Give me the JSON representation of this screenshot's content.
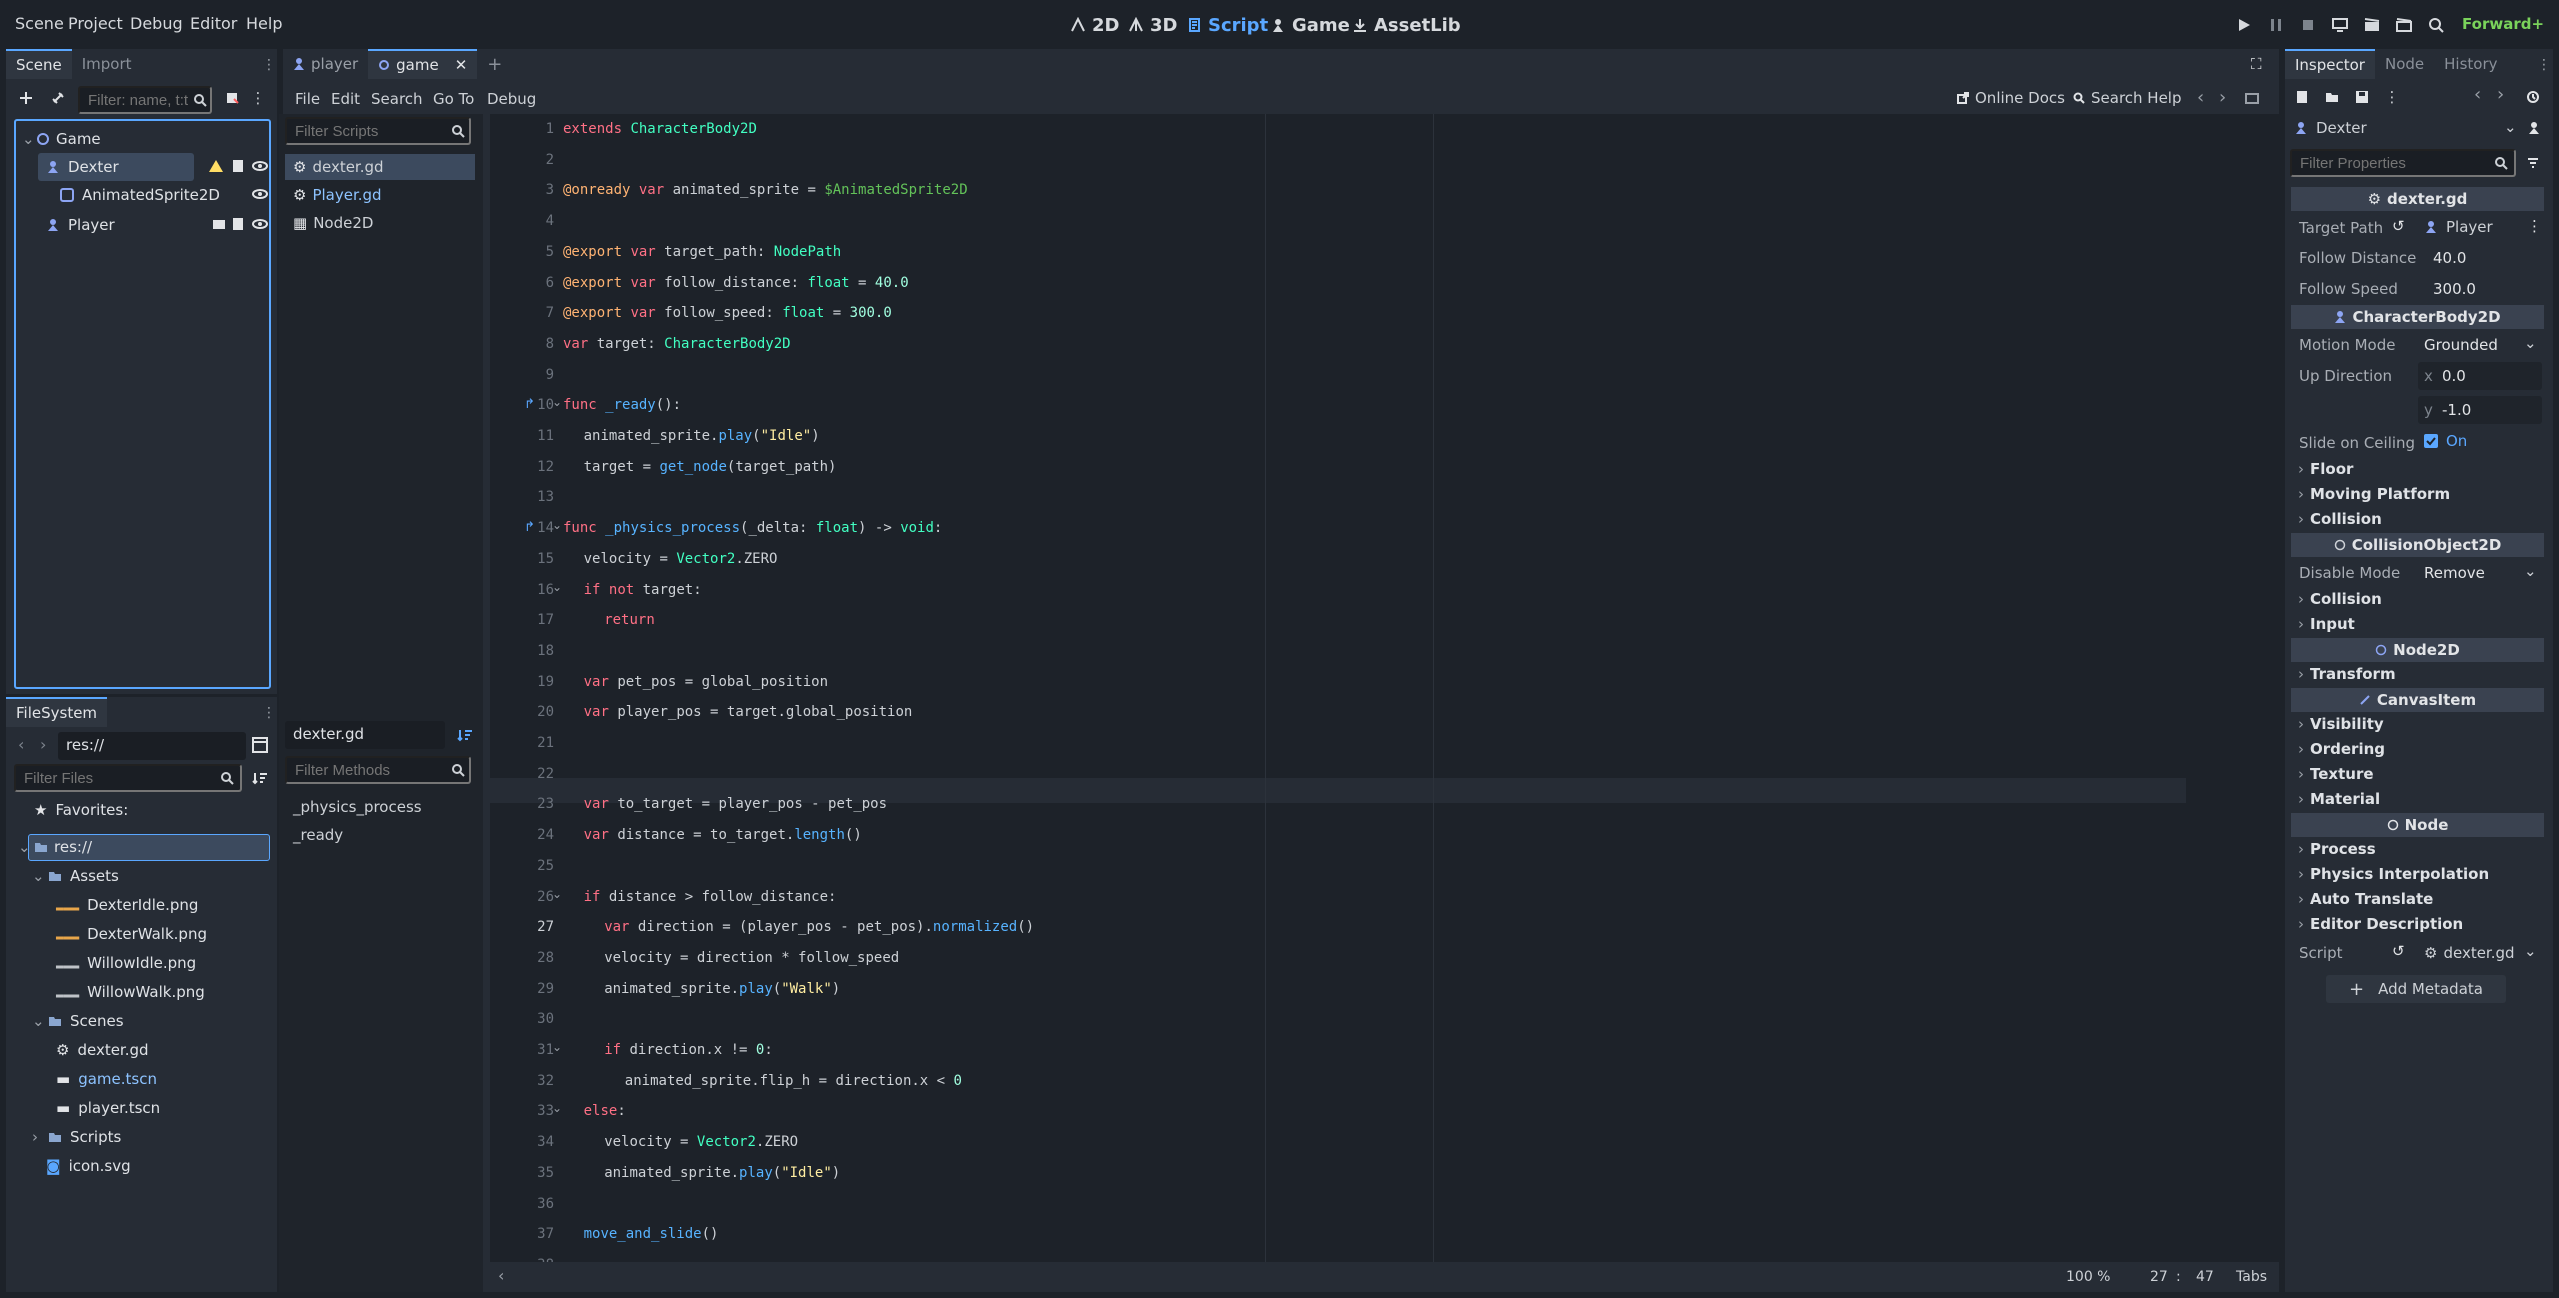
{
  "menu": {
    "items": [
      "Scene",
      "Project",
      "Debug",
      "Editor",
      "Help"
    ]
  },
  "workspaces": [
    {
      "label": "2D",
      "icon": "2d-icon"
    },
    {
      "label": "3D",
      "icon": "3d-icon"
    },
    {
      "label": "Script",
      "icon": "script-icon",
      "active": true
    },
    {
      "label": "Game",
      "icon": "game-icon"
    },
    {
      "label": "AssetLib",
      "icon": "assetlib-icon"
    }
  ],
  "renderer": "Forward+",
  "scene_dock": {
    "tabs": [
      "Scene",
      "Import"
    ],
    "filter_placeholder": "Filter: name, t:t",
    "tree": [
      {
        "label": "Game",
        "indent": 0
      },
      {
        "label": "Dexter",
        "indent": 1
      },
      {
        "label": "AnimatedSprite2D",
        "indent": 2
      },
      {
        "label": "Player",
        "indent": 1
      }
    ]
  },
  "filesystem": {
    "tab": "FileSystem",
    "path": "res://",
    "filter_placeholder": "Filter Files",
    "tree": [
      {
        "label": "Favorites:"
      },
      {
        "label": "res://"
      },
      {
        "label": "Assets"
      },
      {
        "label": "DexterIdle.png"
      },
      {
        "label": "DexterWalk.png"
      },
      {
        "label": "WillowIdle.png"
      },
      {
        "label": "WillowWalk.png"
      },
      {
        "label": "Scenes"
      },
      {
        "label": "dexter.gd"
      },
      {
        "label": "game.tscn"
      },
      {
        "label": "player.tscn"
      },
      {
        "label": "Scripts"
      },
      {
        "label": "icon.svg"
      }
    ]
  },
  "editor_tabs": [
    "player",
    "game"
  ],
  "script_menu": [
    "File",
    "Edit",
    "Search",
    "Go To",
    "Debug"
  ],
  "script_toolbar": {
    "online_docs": "Online Docs",
    "search_help": "Search Help"
  },
  "script_panel": {
    "filter_scripts": "Filter Scripts",
    "scripts": [
      "dexter.gd",
      "Player.gd",
      "Node2D"
    ],
    "current": "dexter.gd",
    "filter_methods": "Filter Methods",
    "methods": [
      "_physics_process",
      "_ready"
    ]
  },
  "code": {
    "lines": [
      "extends CharacterBody2D",
      "",
      "@onready var animated_sprite = $AnimatedSprite2D",
      "",
      "@export var target_path: NodePath",
      "@export var follow_distance: float = 40.0",
      "@export var follow_speed: float = 300.0",
      "var target: CharacterBody2D",
      "",
      "func _ready():",
      "  animated_sprite.play(\"Idle\")",
      "  target = get_node(target_path)",
      "",
      "func _physics_process(_delta: float) -> void:",
      "  velocity = Vector2.ZERO",
      "  if not target:",
      "    return",
      "",
      "  var pet_pos = global_position",
      "  var player_pos = target.global_position",
      "",
      "",
      "  var to_target = player_pos - pet_pos",
      "  var distance = to_target.length()",
      "",
      "  if distance > follow_distance:",
      "    var direction = (player_pos - pet_pos).normalized()",
      "    velocity = direction * follow_speed",
      "    animated_sprite.play(\"Walk\")",
      "",
      "    if direction.x != 0:",
      "      animated_sprite.flip_h = direction.x < 0",
      "  else:",
      "    velocity = Vector2.ZERO",
      "    animated_sprite.play(\"Idle\")",
      "",
      "  move_and_slide()",
      ""
    ]
  },
  "status": {
    "zoom": "100 %",
    "line": "27",
    "col": "47",
    "indent": "Tabs"
  },
  "inspector": {
    "tabs": [
      "Inspector",
      "Node",
      "History"
    ],
    "object": "Dexter",
    "filter_placeholder": "Filter Properties",
    "script_section": "dexter.gd",
    "target_path_label": "Target Path",
    "target_path_value": "Player",
    "follow_distance_label": "Follow Distance",
    "follow_distance_value": "40.0",
    "follow_speed_label": "Follow Speed",
    "follow_speed_value": "300.0",
    "cb2d_section": "CharacterBody2D",
    "motion_mode_label": "Motion Mode",
    "motion_mode_value": "Grounded",
    "up_direction_label": "Up Direction",
    "up_x_label": "x",
    "up_x_value": "0.0",
    "up_y_label": "y",
    "up_y_value": "-1.0",
    "slide_label": "Slide on Ceiling",
    "slide_value": "On",
    "group1": [
      "Floor",
      "Moving Platform",
      "Collision"
    ],
    "co2d_section": "CollisionObject2D",
    "disable_mode_label": "Disable Mode",
    "disable_mode_value": "Remove",
    "group2": [
      "Collision",
      "Input"
    ],
    "node2d_section": "Node2D",
    "group3": [
      "Transform"
    ],
    "canvas_section": "CanvasItem",
    "group4": [
      "Visibility",
      "Ordering",
      "Texture",
      "Material"
    ],
    "node_section": "Node",
    "group5": [
      "Process",
      "Physics Interpolation",
      "Auto Translate",
      "Editor Description"
    ],
    "script_label": "Script",
    "script_value": "dexter.gd",
    "add_metadata": "Add Metadata"
  }
}
